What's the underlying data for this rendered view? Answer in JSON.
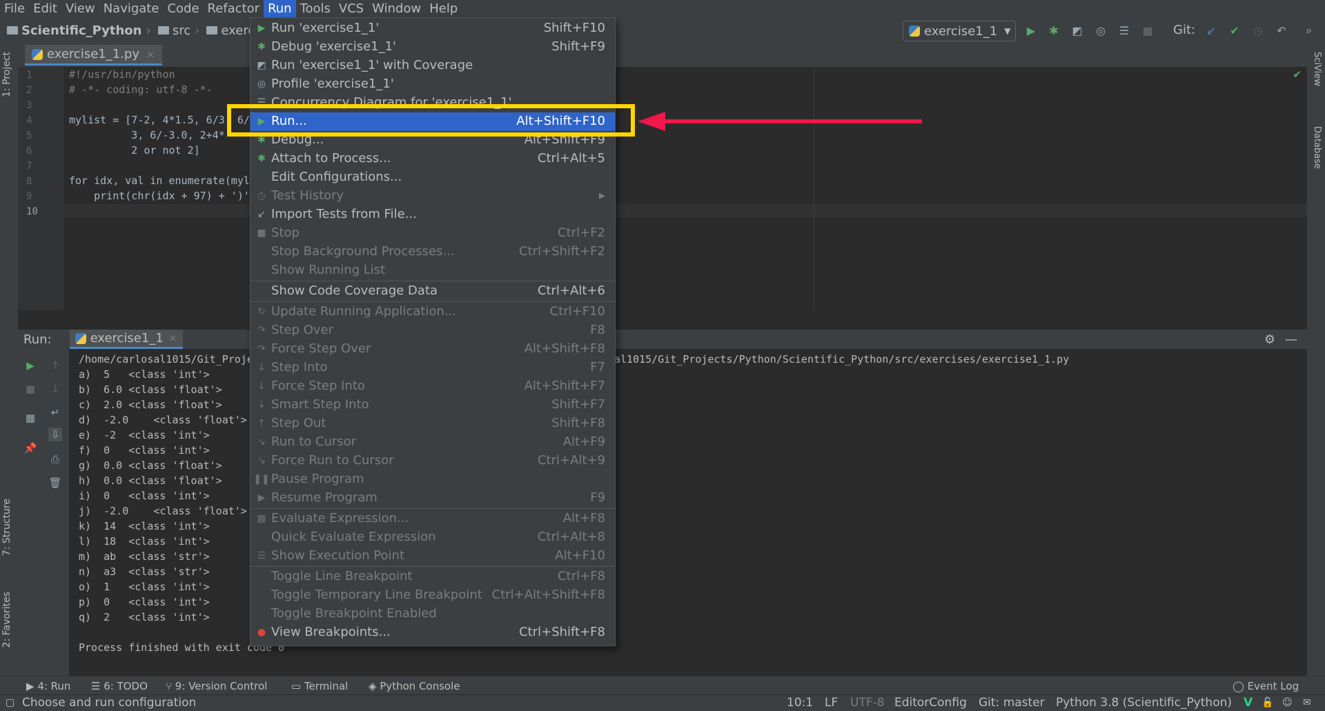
{
  "menubar": [
    "File",
    "Edit",
    "View",
    "Navigate",
    "Code",
    "Refactor",
    "Run",
    "Tools",
    "VCS",
    "Window",
    "Help"
  ],
  "menubar_active": "Run",
  "breadcrumb": {
    "project": "Scientific_Python",
    "src": "src",
    "partial": "exerci"
  },
  "run_config": {
    "name": "exercise1_1"
  },
  "git_label": "Git:",
  "editor_tab": {
    "name": "exercise1_1.py",
    "close": "×"
  },
  "line_numbers": [
    "1",
    "2",
    "3",
    "4",
    "5",
    "6",
    "7",
    "8",
    "9",
    "10"
  ],
  "code_lines": [
    {
      "text": "#!/usr/bin/python",
      "kind": "comment"
    },
    {
      "text": "# -*- coding: utf-8 -*-",
      "kind": "comment"
    },
    {
      "text": "",
      "kind": "plain"
    },
    {
      "text": "mylist = [7-2, 4*1.5, 6/3, 6/",
      "kind": "plain"
    },
    {
      "text": "          3, 6/-3.0, 2+4*",
      "kind": "plain"
    },
    {
      "text": "          2 or not 2]",
      "kind": "plain"
    },
    {
      "text": "",
      "kind": "plain"
    },
    {
      "text": "for idx, val in enumerate(myl",
      "kind": "plain"
    },
    {
      "text": "    print(chr(idx + 97) + ')'",
      "kind": "plain"
    },
    {
      "text": "",
      "kind": "plain"
    }
  ],
  "run_panel": {
    "title": "Run:",
    "tab": "exercise1_1",
    "close": "×"
  },
  "console": {
    "path_left": "/home/carlosal1015/Git_Proje",
    "path_right": "al1015/Git_Projects/Python/Scientific_Python/src/exercises/exercise1_1.py",
    "lines": [
      "a)  5   <class 'int'>",
      "b)  6.0 <class 'float'>",
      "c)  2.0 <class 'float'>",
      "d)  -2.0    <class 'float'>",
      "e)  -2  <class 'int'>",
      "f)  0   <class 'int'>",
      "g)  0.0 <class 'float'>",
      "h)  0.0 <class 'float'>",
      "i)  0   <class 'int'>",
      "j)  -2.0    <class 'float'>",
      "k)  14  <class 'int'>",
      "l)  18  <class 'int'>",
      "m)  ab  <class 'str'>",
      "n)  a3  <class 'str'>",
      "o)  1   <class 'int'>",
      "p)  0   <class 'int'>",
      "q)  2   <class 'int'>"
    ],
    "finished": "Process finished with exit code 0"
  },
  "run_menu": [
    {
      "label": "Run 'exercise1_1'",
      "shortcut": "Shift+F10",
      "icon": "run-icon",
      "state": "normal"
    },
    {
      "label": "Debug 'exercise1_1'",
      "shortcut": "Shift+F9",
      "icon": "debug-icon",
      "state": "normal"
    },
    {
      "label": "Run 'exercise1_1' with Coverage",
      "shortcut": "",
      "icon": "coverage-icon",
      "state": "normal"
    },
    {
      "label": "Profile 'exercise1_1'",
      "shortcut": "",
      "icon": "profile-icon",
      "state": "normal"
    },
    {
      "label": "Concurrency Diagram for 'exercise1_1'",
      "shortcut": "",
      "icon": "concurrency-icon",
      "state": "normal"
    },
    {
      "label": "Run...",
      "shortcut": "Alt+Shift+F10",
      "icon": "run-icon",
      "state": "selected"
    },
    {
      "label": "Debug...",
      "shortcut": "Alt+Shift+F9",
      "icon": "debug-icon",
      "state": "normal"
    },
    {
      "label": "Attach to Process...",
      "shortcut": "Ctrl+Alt+5",
      "icon": "attach-icon",
      "state": "normal"
    },
    {
      "label": "Edit Configurations...",
      "shortcut": "",
      "icon": "",
      "state": "normal"
    },
    {
      "label": "Test History",
      "shortcut": "",
      "icon": "history-icon",
      "state": "disabled",
      "submenu": true
    },
    {
      "label": "Import Tests from File...",
      "shortcut": "",
      "icon": "import-icon",
      "state": "normal"
    },
    {
      "label": "Stop",
      "shortcut": "Ctrl+F2",
      "icon": "stop-icon",
      "state": "disabled"
    },
    {
      "label": "Stop Background Processes...",
      "shortcut": "Ctrl+Shift+F2",
      "icon": "",
      "state": "disabled"
    },
    {
      "label": "Show Running List",
      "shortcut": "",
      "icon": "",
      "state": "disabled"
    },
    {
      "label": "Show Code Coverage Data",
      "shortcut": "Ctrl+Alt+6",
      "icon": "",
      "state": "normal",
      "sep_before": true
    },
    {
      "label": "Update Running Application...",
      "shortcut": "Ctrl+F10",
      "icon": "update-icon",
      "state": "disabled",
      "sep_before": true
    },
    {
      "label": "Step Over",
      "shortcut": "F8",
      "icon": "step-over-icon",
      "state": "disabled"
    },
    {
      "label": "Force Step Over",
      "shortcut": "Alt+Shift+F8",
      "icon": "force-step-over-icon",
      "state": "disabled"
    },
    {
      "label": "Step Into",
      "shortcut": "F7",
      "icon": "step-into-icon",
      "state": "disabled"
    },
    {
      "label": "Force Step Into",
      "shortcut": "Alt+Shift+F7",
      "icon": "force-step-into-icon",
      "state": "disabled"
    },
    {
      "label": "Smart Step Into",
      "shortcut": "Shift+F7",
      "icon": "smart-step-into-icon",
      "state": "disabled"
    },
    {
      "label": "Step Out",
      "shortcut": "Shift+F8",
      "icon": "step-out-icon",
      "state": "disabled"
    },
    {
      "label": "Run to Cursor",
      "shortcut": "Alt+F9",
      "icon": "run-to-cursor-icon",
      "state": "disabled"
    },
    {
      "label": "Force Run to Cursor",
      "shortcut": "Ctrl+Alt+9",
      "icon": "force-run-to-cursor-icon",
      "state": "disabled"
    },
    {
      "label": "Pause Program",
      "shortcut": "",
      "icon": "pause-icon",
      "state": "disabled"
    },
    {
      "label": "Resume Program",
      "shortcut": "F9",
      "icon": "resume-icon",
      "state": "disabled"
    },
    {
      "label": "Evaluate Expression...",
      "shortcut": "Alt+F8",
      "icon": "evaluate-icon",
      "state": "disabled",
      "sep_before": true
    },
    {
      "label": "Quick Evaluate Expression",
      "shortcut": "Ctrl+Alt+8",
      "icon": "",
      "state": "disabled"
    },
    {
      "label": "Show Execution Point",
      "shortcut": "Alt+F10",
      "icon": "execution-point-icon",
      "state": "disabled"
    },
    {
      "label": "Toggle Line Breakpoint",
      "shortcut": "Ctrl+F8",
      "icon": "",
      "state": "disabled",
      "sep_before": true
    },
    {
      "label": "Toggle Temporary Line Breakpoint",
      "shortcut": "Ctrl+Alt+Shift+F8",
      "icon": "",
      "state": "disabled"
    },
    {
      "label": "Toggle Breakpoint Enabled",
      "shortcut": "",
      "icon": "",
      "state": "disabled"
    },
    {
      "label": "View Breakpoints...",
      "shortcut": "Ctrl+Shift+F8",
      "icon": "breakpoints-icon",
      "state": "normal"
    }
  ],
  "left_tool_tabs": [
    "1: Project",
    "7: Structure",
    "2: Favorites"
  ],
  "right_tool_tabs": [
    "SciView",
    "Database"
  ],
  "bottom_tabs": [
    "4: Run",
    "6: TODO",
    "9: Version Control",
    "Terminal",
    "Python Console"
  ],
  "event_log": "Event Log",
  "status": {
    "message": "Choose and run configuration",
    "position": "10:1",
    "line_sep": "LF",
    "encoding": "UTF-8",
    "editorconfig": "EditorConfig",
    "git": "Git: master",
    "interpreter": "Python 3.8 (Scientific_Python)"
  },
  "colors": {
    "accent": "#2f65ca",
    "highlight": "#ffd700",
    "arrow": "#f0174a",
    "run_green": "#59a869"
  }
}
